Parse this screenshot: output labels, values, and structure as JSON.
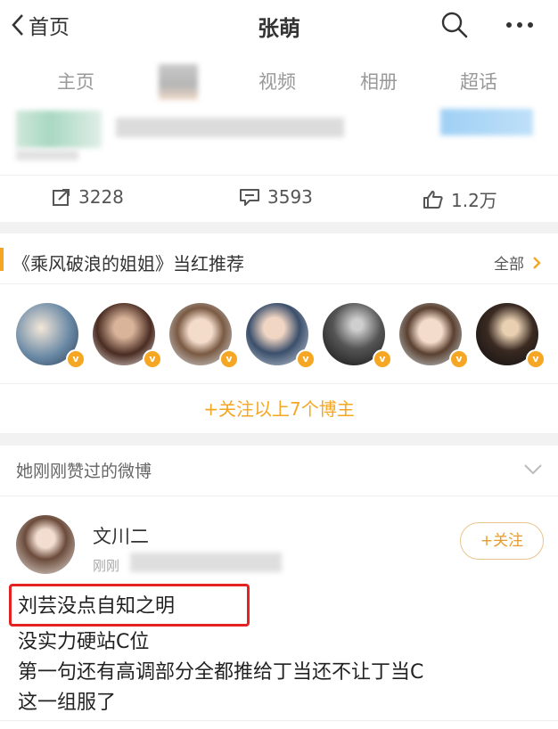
{
  "header": {
    "back_label": "首页",
    "title": "张萌"
  },
  "tabs": [
    "主页",
    "视频",
    "相册",
    "超话"
  ],
  "stats": {
    "reposts": "3228",
    "comments": "3593",
    "likes": "1.2万"
  },
  "recommend": {
    "title": "《乘风破浪的姐姐》当红推荐",
    "all_label": "全部",
    "badge": "v",
    "follow_all_label": "+关注以上7个博主"
  },
  "liked": {
    "title": "她刚刚赞过的微博"
  },
  "post": {
    "username": "文川二",
    "time": "刚刚",
    "follow_label": "+关注",
    "lines": [
      "刘芸没点自知之明",
      "没实力硬站C位",
      "第一句还有高调部分全都推给丁当还不让丁当C",
      "这一组服了"
    ]
  },
  "colors": {
    "accent": "#f5a623",
    "highlight": "#e52222"
  }
}
